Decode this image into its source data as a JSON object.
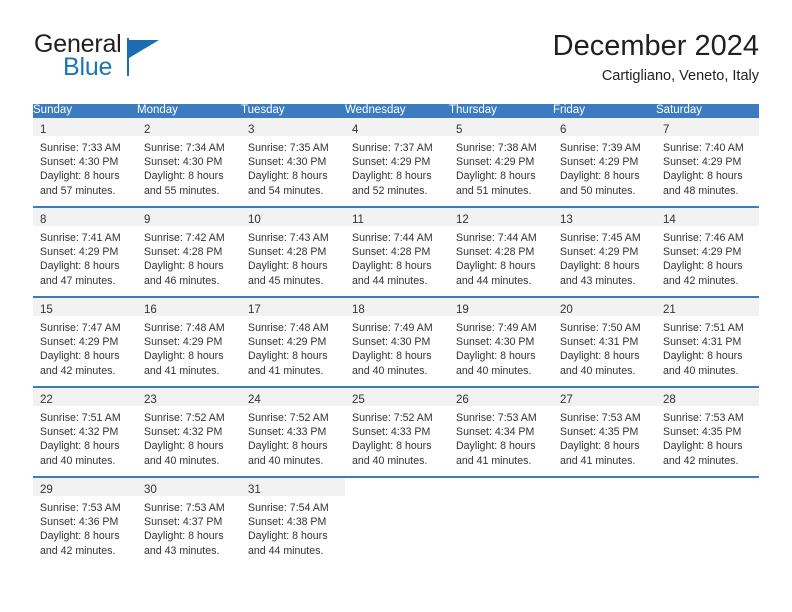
{
  "brand": {
    "word_one": "General",
    "word_two": "Blue",
    "flag_icon": "triangle-flag-icon",
    "accent_color": "#1b6cb0"
  },
  "header": {
    "title": "December 2024",
    "subtitle": "Cartigliano, Veneto, Italy"
  },
  "calendar": {
    "header_color": "#3b7cc0",
    "weekday_headers": [
      "Sunday",
      "Monday",
      "Tuesday",
      "Wednesday",
      "Thursday",
      "Friday",
      "Saturday"
    ],
    "weeks": [
      [
        {
          "day": "1",
          "sunrise": "Sunrise: 7:33 AM",
          "sunset": "Sunset: 4:30 PM",
          "daylight_1": "Daylight: 8 hours",
          "daylight_2": "and 57 minutes."
        },
        {
          "day": "2",
          "sunrise": "Sunrise: 7:34 AM",
          "sunset": "Sunset: 4:30 PM",
          "daylight_1": "Daylight: 8 hours",
          "daylight_2": "and 55 minutes."
        },
        {
          "day": "3",
          "sunrise": "Sunrise: 7:35 AM",
          "sunset": "Sunset: 4:30 PM",
          "daylight_1": "Daylight: 8 hours",
          "daylight_2": "and 54 minutes."
        },
        {
          "day": "4",
          "sunrise": "Sunrise: 7:37 AM",
          "sunset": "Sunset: 4:29 PM",
          "daylight_1": "Daylight: 8 hours",
          "daylight_2": "and 52 minutes."
        },
        {
          "day": "5",
          "sunrise": "Sunrise: 7:38 AM",
          "sunset": "Sunset: 4:29 PM",
          "daylight_1": "Daylight: 8 hours",
          "daylight_2": "and 51 minutes."
        },
        {
          "day": "6",
          "sunrise": "Sunrise: 7:39 AM",
          "sunset": "Sunset: 4:29 PM",
          "daylight_1": "Daylight: 8 hours",
          "daylight_2": "and 50 minutes."
        },
        {
          "day": "7",
          "sunrise": "Sunrise: 7:40 AM",
          "sunset": "Sunset: 4:29 PM",
          "daylight_1": "Daylight: 8 hours",
          "daylight_2": "and 48 minutes."
        }
      ],
      [
        {
          "day": "8",
          "sunrise": "Sunrise: 7:41 AM",
          "sunset": "Sunset: 4:29 PM",
          "daylight_1": "Daylight: 8 hours",
          "daylight_2": "and 47 minutes."
        },
        {
          "day": "9",
          "sunrise": "Sunrise: 7:42 AM",
          "sunset": "Sunset: 4:28 PM",
          "daylight_1": "Daylight: 8 hours",
          "daylight_2": "and 46 minutes."
        },
        {
          "day": "10",
          "sunrise": "Sunrise: 7:43 AM",
          "sunset": "Sunset: 4:28 PM",
          "daylight_1": "Daylight: 8 hours",
          "daylight_2": "and 45 minutes."
        },
        {
          "day": "11",
          "sunrise": "Sunrise: 7:44 AM",
          "sunset": "Sunset: 4:28 PM",
          "daylight_1": "Daylight: 8 hours",
          "daylight_2": "and 44 minutes."
        },
        {
          "day": "12",
          "sunrise": "Sunrise: 7:44 AM",
          "sunset": "Sunset: 4:28 PM",
          "daylight_1": "Daylight: 8 hours",
          "daylight_2": "and 44 minutes."
        },
        {
          "day": "13",
          "sunrise": "Sunrise: 7:45 AM",
          "sunset": "Sunset: 4:29 PM",
          "daylight_1": "Daylight: 8 hours",
          "daylight_2": "and 43 minutes."
        },
        {
          "day": "14",
          "sunrise": "Sunrise: 7:46 AM",
          "sunset": "Sunset: 4:29 PM",
          "daylight_1": "Daylight: 8 hours",
          "daylight_2": "and 42 minutes."
        }
      ],
      [
        {
          "day": "15",
          "sunrise": "Sunrise: 7:47 AM",
          "sunset": "Sunset: 4:29 PM",
          "daylight_1": "Daylight: 8 hours",
          "daylight_2": "and 42 minutes."
        },
        {
          "day": "16",
          "sunrise": "Sunrise: 7:48 AM",
          "sunset": "Sunset: 4:29 PM",
          "daylight_1": "Daylight: 8 hours",
          "daylight_2": "and 41 minutes."
        },
        {
          "day": "17",
          "sunrise": "Sunrise: 7:48 AM",
          "sunset": "Sunset: 4:29 PM",
          "daylight_1": "Daylight: 8 hours",
          "daylight_2": "and 41 minutes."
        },
        {
          "day": "18",
          "sunrise": "Sunrise: 7:49 AM",
          "sunset": "Sunset: 4:30 PM",
          "daylight_1": "Daylight: 8 hours",
          "daylight_2": "and 40 minutes."
        },
        {
          "day": "19",
          "sunrise": "Sunrise: 7:49 AM",
          "sunset": "Sunset: 4:30 PM",
          "daylight_1": "Daylight: 8 hours",
          "daylight_2": "and 40 minutes."
        },
        {
          "day": "20",
          "sunrise": "Sunrise: 7:50 AM",
          "sunset": "Sunset: 4:31 PM",
          "daylight_1": "Daylight: 8 hours",
          "daylight_2": "and 40 minutes."
        },
        {
          "day": "21",
          "sunrise": "Sunrise: 7:51 AM",
          "sunset": "Sunset: 4:31 PM",
          "daylight_1": "Daylight: 8 hours",
          "daylight_2": "and 40 minutes."
        }
      ],
      [
        {
          "day": "22",
          "sunrise": "Sunrise: 7:51 AM",
          "sunset": "Sunset: 4:32 PM",
          "daylight_1": "Daylight: 8 hours",
          "daylight_2": "and 40 minutes."
        },
        {
          "day": "23",
          "sunrise": "Sunrise: 7:52 AM",
          "sunset": "Sunset: 4:32 PM",
          "daylight_1": "Daylight: 8 hours",
          "daylight_2": "and 40 minutes."
        },
        {
          "day": "24",
          "sunrise": "Sunrise: 7:52 AM",
          "sunset": "Sunset: 4:33 PM",
          "daylight_1": "Daylight: 8 hours",
          "daylight_2": "and 40 minutes."
        },
        {
          "day": "25",
          "sunrise": "Sunrise: 7:52 AM",
          "sunset": "Sunset: 4:33 PM",
          "daylight_1": "Daylight: 8 hours",
          "daylight_2": "and 40 minutes."
        },
        {
          "day": "26",
          "sunrise": "Sunrise: 7:53 AM",
          "sunset": "Sunset: 4:34 PM",
          "daylight_1": "Daylight: 8 hours",
          "daylight_2": "and 41 minutes."
        },
        {
          "day": "27",
          "sunrise": "Sunrise: 7:53 AM",
          "sunset": "Sunset: 4:35 PM",
          "daylight_1": "Daylight: 8 hours",
          "daylight_2": "and 41 minutes."
        },
        {
          "day": "28",
          "sunrise": "Sunrise: 7:53 AM",
          "sunset": "Sunset: 4:35 PM",
          "daylight_1": "Daylight: 8 hours",
          "daylight_2": "and 42 minutes."
        }
      ],
      [
        {
          "day": "29",
          "sunrise": "Sunrise: 7:53 AM",
          "sunset": "Sunset: 4:36 PM",
          "daylight_1": "Daylight: 8 hours",
          "daylight_2": "and 42 minutes."
        },
        {
          "day": "30",
          "sunrise": "Sunrise: 7:53 AM",
          "sunset": "Sunset: 4:37 PM",
          "daylight_1": "Daylight: 8 hours",
          "daylight_2": "and 43 minutes."
        },
        {
          "day": "31",
          "sunrise": "Sunrise: 7:54 AM",
          "sunset": "Sunset: 4:38 PM",
          "daylight_1": "Daylight: 8 hours",
          "daylight_2": "and 44 minutes."
        },
        {
          "day": "",
          "sunrise": "",
          "sunset": "",
          "daylight_1": "",
          "daylight_2": ""
        },
        {
          "day": "",
          "sunrise": "",
          "sunset": "",
          "daylight_1": "",
          "daylight_2": ""
        },
        {
          "day": "",
          "sunrise": "",
          "sunset": "",
          "daylight_1": "",
          "daylight_2": ""
        },
        {
          "day": "",
          "sunrise": "",
          "sunset": "",
          "daylight_1": "",
          "daylight_2": ""
        }
      ]
    ]
  }
}
